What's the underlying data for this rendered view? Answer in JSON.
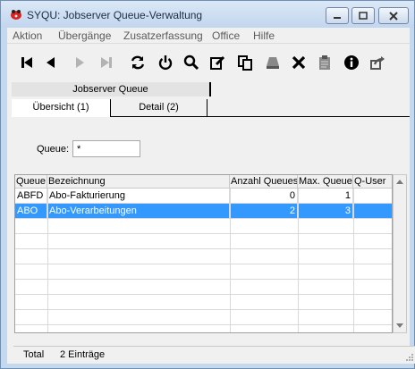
{
  "window": {
    "title": "SYQU: Jobserver Queue-Verwaltung",
    "app_icon": "bug-icon"
  },
  "menu": {
    "items": [
      {
        "label": "Aktion"
      },
      {
        "label": "Übergänge"
      },
      {
        "label": "Zusatzerfassung"
      },
      {
        "label": "Office"
      },
      {
        "label": "Hilfe"
      }
    ]
  },
  "toolbar": {
    "buttons": [
      "first-icon",
      "previous-icon",
      "next-icon",
      "last-icon",
      "refresh-icon",
      "power-icon",
      "search-icon",
      "edit-icon",
      "copy-icon",
      "eraser-icon",
      "delete-icon",
      "clipboard-icon",
      "info-icon",
      "export-icon"
    ]
  },
  "tabs": {
    "group_title": "Jobserver Queue",
    "items": [
      {
        "label": "Übersicht (1)",
        "active": true
      },
      {
        "label": "Detail (2)",
        "active": false
      }
    ]
  },
  "filter": {
    "queue_label": "Queue:",
    "queue_value": "*"
  },
  "table": {
    "columns": [
      "Queue",
      "Bezeichnung",
      "Anzahl Queues",
      "Max. Queue",
      "Q-User"
    ],
    "rows": [
      {
        "queue": "ABFD",
        "bezeichnung": "Abo-Fakturierung",
        "anzahl": "0",
        "max": "1",
        "quser": "",
        "selected": false
      },
      {
        "queue": "ABO",
        "bezeichnung": "Abo-Verarbeitungen",
        "anzahl": "2",
        "max": "3",
        "quser": "",
        "selected": true
      }
    ]
  },
  "status": {
    "label": "Total",
    "value": "2 Einträge"
  },
  "colors": {
    "selection": "#3399ff",
    "titlebar": "#c4d8ee"
  }
}
